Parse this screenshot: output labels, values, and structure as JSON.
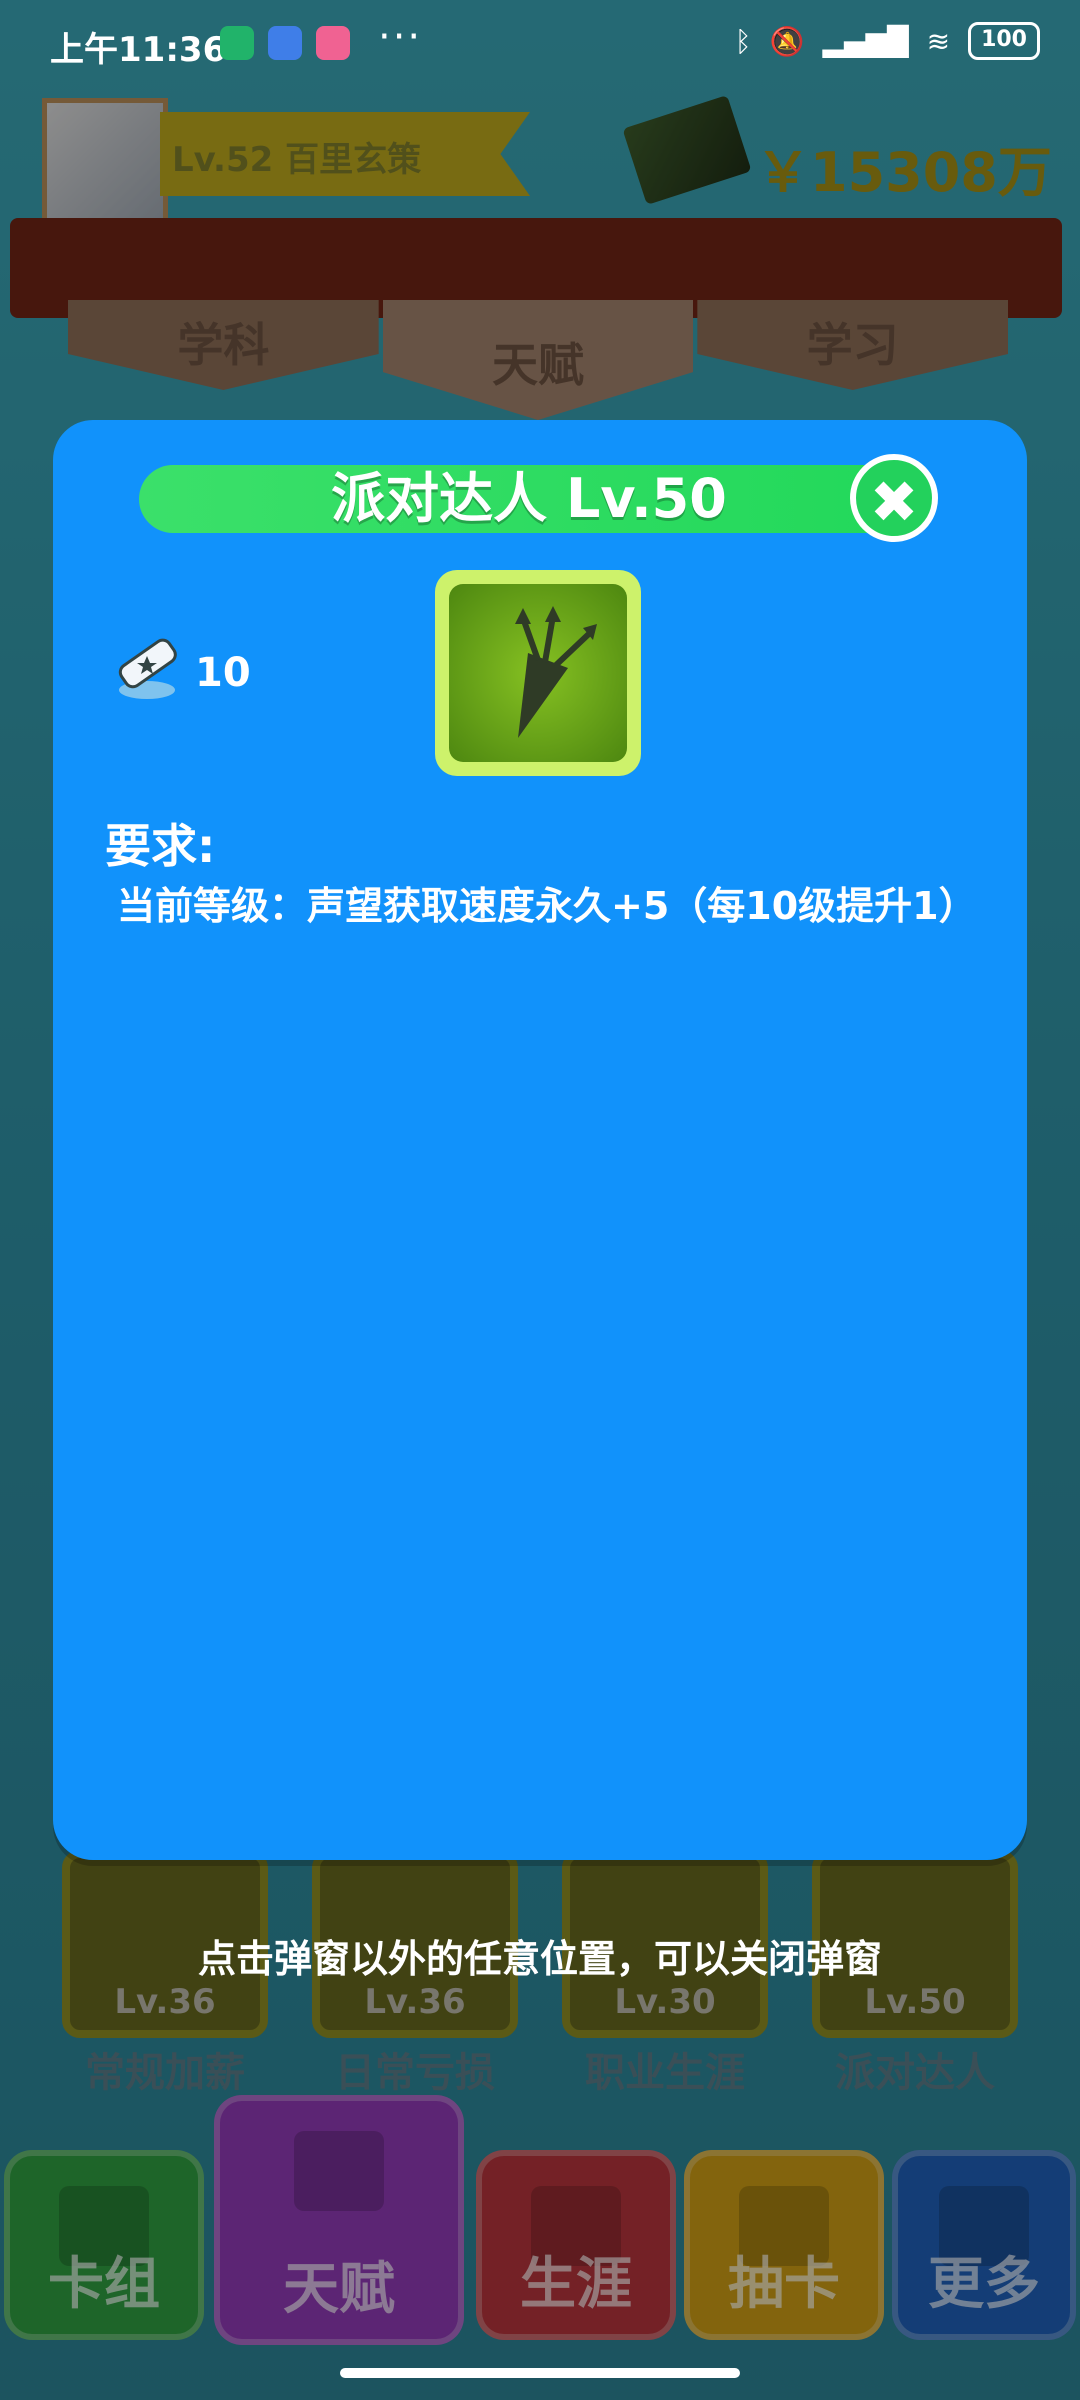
{
  "status_bar": {
    "time": "上午11:36",
    "more": "···",
    "battery": "100"
  },
  "header": {
    "level_name": "Lv.52 百里玄策",
    "money": "￥15308万"
  },
  "tabs": [
    {
      "label": "学科"
    },
    {
      "label": "天赋",
      "active": true
    },
    {
      "label": "学习"
    }
  ],
  "dialog": {
    "title": "派对达人 Lv.50",
    "close_symbol": "✖",
    "cost": "10",
    "requirement_title": "要求:",
    "requirement_text": "当前等级：声望获取速度永久+5（每10级提升1）"
  },
  "hint": "点击弹窗以外的任意位置，可以关闭弹窗",
  "cards": [
    {
      "level": "Lv.36",
      "name": "常规加薪"
    },
    {
      "level": "Lv.36",
      "name": "日常亏损"
    },
    {
      "level": "Lv.30",
      "name": "职业生涯"
    },
    {
      "level": "Lv.50",
      "name": "派对达人"
    }
  ],
  "bottom_nav": [
    {
      "label": "卡组",
      "color": "#2f9c3f"
    },
    {
      "label": "天赋",
      "color": "#8e39b2",
      "active": true
    },
    {
      "label": "生涯",
      "color": "#b2343b"
    },
    {
      "label": "抽卡",
      "color": "#c99a14"
    },
    {
      "label": "更多",
      "color": "#1f5fb5"
    }
  ]
}
